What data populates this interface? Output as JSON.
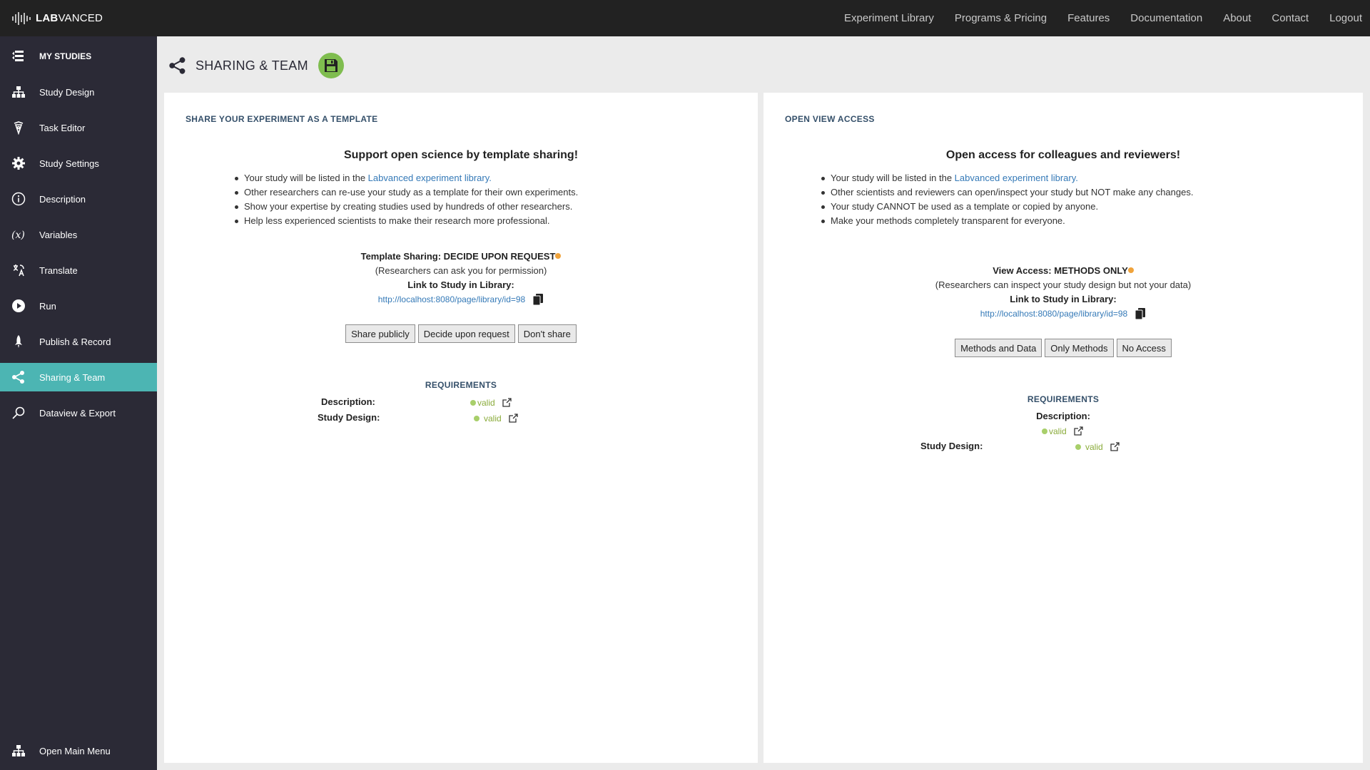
{
  "app": {
    "logo_bold": "LAB",
    "logo_rest": "VANCED"
  },
  "topnav": [
    "Experiment Library",
    "Programs & Pricing",
    "Features",
    "Documentation",
    "About",
    "Contact",
    "Logout"
  ],
  "sidebar": {
    "items": [
      {
        "label": "MY STUDIES",
        "icon": "studies-icon"
      },
      {
        "label": "Study Design",
        "icon": "hierarchy-icon"
      },
      {
        "label": "Task Editor",
        "icon": "pen-nib-icon"
      },
      {
        "label": "Study Settings",
        "icon": "gear-icon"
      },
      {
        "label": "Description",
        "icon": "info-icon"
      },
      {
        "label": "Variables",
        "icon": "variable-icon"
      },
      {
        "label": "Translate",
        "icon": "translate-icon"
      },
      {
        "label": "Run",
        "icon": "play-icon"
      },
      {
        "label": "Publish & Record",
        "icon": "rocket-icon"
      },
      {
        "label": "Sharing & Team",
        "icon": "share-icon"
      },
      {
        "label": "Dataview & Export",
        "icon": "search-icon"
      }
    ],
    "footer": {
      "label": "Open Main Menu",
      "icon": "hierarchy-icon"
    },
    "active_index": 9
  },
  "header": {
    "title": "SHARING & TEAM"
  },
  "template_panel": {
    "title": "SHARE YOUR EXPERIMENT AS A TEMPLATE",
    "headline": "Support open science by template sharing!",
    "bullet1_prefix": "Your study will be listed in the ",
    "bullet1_link": "Labvanced experiment library.",
    "bullet2": "Other researchers can re-use your study as a template for their own experiments.",
    "bullet3": "Show your expertise by creating studies used by hundreds of other researchers.",
    "bullet4": "Help less experienced scientists to make their research more professional.",
    "status_label": "Template Sharing: DECIDE UPON REQUEST",
    "status_note": "(Researchers can ask you for permission)",
    "link_label": "Link to Study in Library:",
    "link_url": "http://localhost:8080/page/library/id=98",
    "buttons": [
      "Share publicly",
      "Decide upon request",
      "Don't share"
    ],
    "requirements_title": "REQUIREMENTS",
    "req_description_label": "Description:",
    "req_description_value": "valid",
    "req_design_label": "Study Design:",
    "req_design_value": "valid"
  },
  "view_panel": {
    "title": "OPEN VIEW ACCESS",
    "headline": "Open access for colleagues and reviewers!",
    "bullet1_prefix": "Your study will be listed in the ",
    "bullet1_link": "Labvanced experiment library.",
    "bullet2": "Other scientists and reviewers can open/inspect your study but NOT make any changes.",
    "bullet3": "Your study CANNOT be used as a template or copied by anyone.",
    "bullet4": "Make your methods completely transparent for everyone.",
    "status_label": "View Access: METHODS ONLY",
    "status_note": "(Researchers can inspect your study design but not your data)",
    "link_label": "Link to Study in Library:",
    "link_url": "http://localhost:8080/page/library/id=98",
    "buttons": [
      "Methods and Data",
      "Only Methods",
      "No Access"
    ],
    "requirements_title": "REQUIREMENTS",
    "req_description_label": "Description:",
    "req_description_value": "valid",
    "req_design_label": "Study Design:",
    "req_design_value": "valid"
  },
  "colors": {
    "accent": "#4cb5b3",
    "sidebar": "#2b2a36",
    "topbar": "#222222",
    "save": "#7fbd4f",
    "status_pending": "#f0a33b",
    "valid": "#a8cf6a"
  }
}
